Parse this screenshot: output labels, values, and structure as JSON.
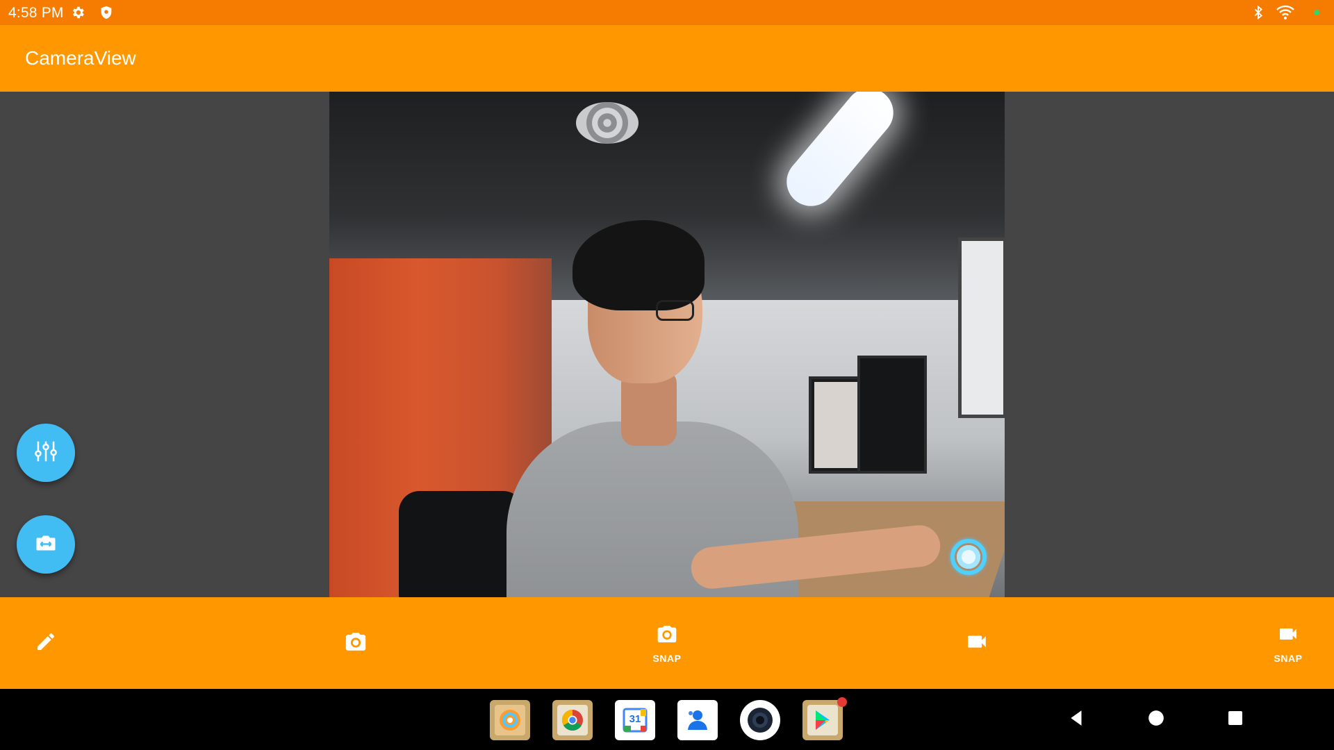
{
  "status_bar": {
    "time": "4:58 PM",
    "icons_left": [
      "gear-icon",
      "shield-icon"
    ],
    "icons_right": [
      "bluetooth-icon",
      "wifi-icon",
      "dot-indicator-icon"
    ]
  },
  "app_bar": {
    "title": "CameraView"
  },
  "side_fabs": [
    {
      "name": "sliders-settings-icon"
    },
    {
      "name": "switch-camera-icon"
    }
  ],
  "bottom_bar": {
    "snap_photo_label": "SNAP",
    "snap_video_label": "SNAP"
  },
  "taskbar": {
    "apps": [
      "camera-app-icon",
      "chrome-icon",
      "calendar-icon",
      "contacts-icon",
      "camera-lens-app-icon",
      "play-store-icon"
    ],
    "calendar_day": "31",
    "nav": [
      "back-icon",
      "home-icon",
      "recents-icon"
    ]
  },
  "colors": {
    "status_bar": "#f57c00",
    "app_bar": "#ff9800",
    "fab": "#42bdf4",
    "background": "#454545"
  }
}
